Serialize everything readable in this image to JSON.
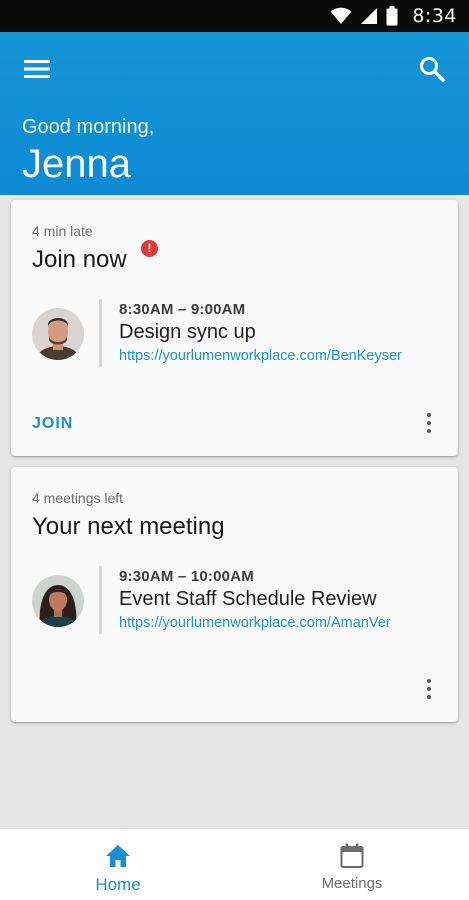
{
  "status_bar": {
    "time": "8:34",
    "icons": [
      "wifi-icon",
      "signal-icon",
      "battery-icon"
    ]
  },
  "header": {
    "greeting": "Good morning,",
    "user_name": "Jenna",
    "icons": [
      "menu-icon",
      "search-icon"
    ]
  },
  "cards": [
    {
      "kicker": "4 min late",
      "heading": "Join now",
      "alert": "!",
      "meeting": {
        "time": "8:30AM – 9:00AM",
        "title": "Design sync up",
        "link": "https://yourlumenworkplace.com/BenKeyser"
      },
      "action_label": "JOIN"
    },
    {
      "kicker": "4 meetings left",
      "heading": "Your next meeting",
      "meeting": {
        "time": "9:30AM – 10:00AM",
        "title": "Event Staff Schedule Review",
        "link": "https://yourlumenworkplace.com/AmanVer"
      }
    }
  ],
  "bottom_nav": [
    {
      "label": "Home",
      "icon": "home-icon",
      "active": true
    },
    {
      "label": "Meetings",
      "icon": "calendar-icon",
      "active": false
    }
  ],
  "colors": {
    "header_blue": "#1595d6",
    "accent_blue": "#1b8fd3",
    "alert_red": "#e53935",
    "background": "#e6e6e6"
  }
}
